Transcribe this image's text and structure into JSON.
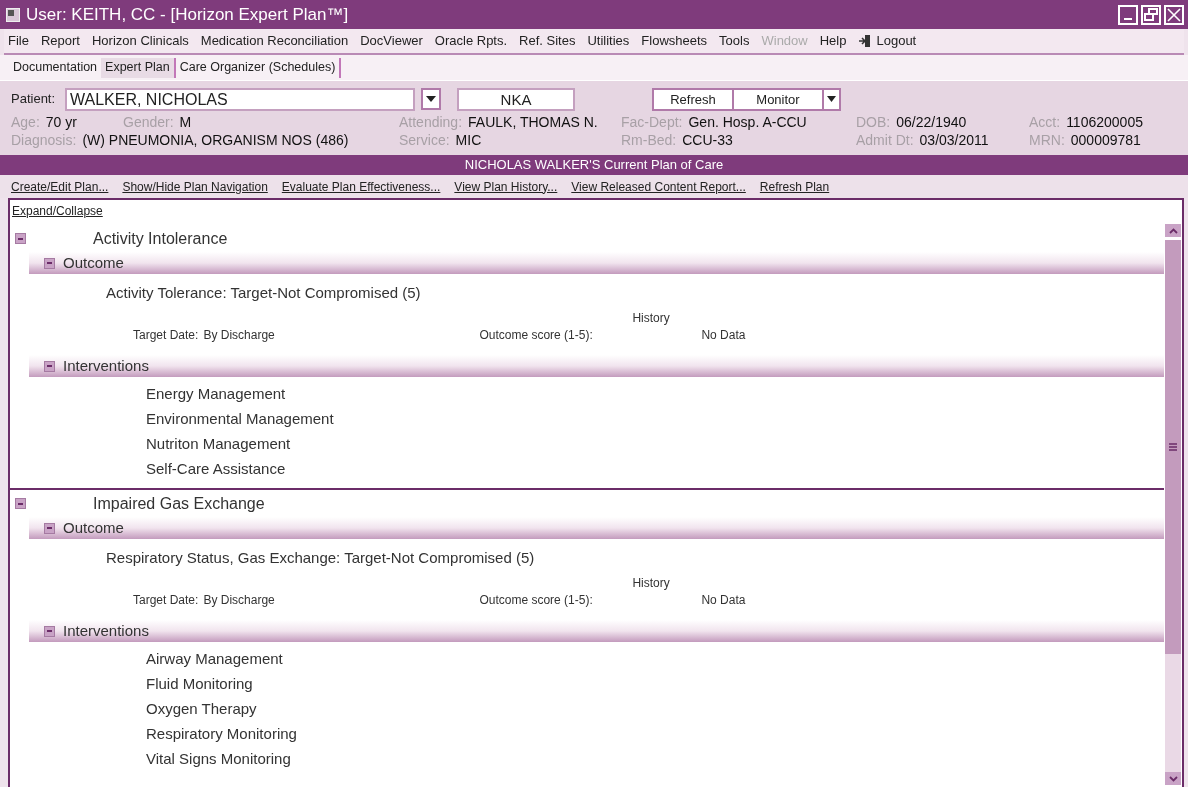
{
  "window": {
    "title": "User: KEITH, CC - [Horizon Expert Plan™]"
  },
  "menu": [
    {
      "label": "File",
      "disabled": false
    },
    {
      "label": "Report",
      "disabled": false
    },
    {
      "label": "Horizon Clinicals",
      "disabled": false
    },
    {
      "label": "Medication Reconciliation",
      "disabled": false
    },
    {
      "label": "DocViewer",
      "disabled": false
    },
    {
      "label": "Oracle Rpts.",
      "disabled": false
    },
    {
      "label": "Ref. Sites",
      "disabled": false
    },
    {
      "label": "Utilities",
      "disabled": false
    },
    {
      "label": "Flowsheets",
      "disabled": false
    },
    {
      "label": "Tools",
      "disabled": false
    },
    {
      "label": "Window",
      "disabled": true
    },
    {
      "label": "Help",
      "disabled": false
    },
    {
      "label": "Logout",
      "disabled": false,
      "kind": "logout"
    }
  ],
  "tabs": [
    {
      "label": "Documentation",
      "selected": false
    },
    {
      "label": "Expert Plan",
      "selected": true
    },
    {
      "label": "Care Organizer (Schedules)",
      "selected": false
    }
  ],
  "patient": {
    "label": "Patient:",
    "value": "WALKER, NICHOLAS",
    "allergy": "NKA",
    "buttons": [
      "Refresh",
      "Monitor"
    ],
    "columns": [
      {
        "lines": [
          [
            {
              "label": "Age:",
              "value": "70 yr"
            },
            {
              "label": "Gender:",
              "value": "M"
            }
          ],
          [
            {
              "label": "Diagnosis:",
              "value": "(W) PNEUMONIA, ORGANISM NOS (486)"
            }
          ]
        ]
      },
      {
        "lines": [
          [
            {
              "label": "Attending:",
              "value": "FAULK, THOMAS N."
            }
          ],
          [
            {
              "label": "Service:",
              "value": "MIC"
            }
          ]
        ]
      },
      {
        "lines": [
          [
            {
              "label": "Fac-Dept:",
              "value": "Gen. Hosp. A-CCU"
            }
          ],
          [
            {
              "label": "Rm-Bed:",
              "value": "CCU-33"
            }
          ]
        ]
      },
      {
        "lines": [
          [
            {
              "label": "DOB:",
              "value": "06/22/1940"
            }
          ],
          [
            {
              "label": "Admit Dt:",
              "value": "03/03/2011"
            }
          ]
        ]
      },
      {
        "lines": [
          [
            {
              "label": "Acct:",
              "value": "1106200005"
            }
          ],
          [
            {
              "label": "MRN:",
              "value": "000009781"
            }
          ]
        ]
      }
    ]
  },
  "plan_header": "NICHOLAS WALKER'S Current Plan of Care",
  "actions": [
    "Create/Edit Plan...",
    "Show/Hide Plan Navigation",
    "Evaluate Plan Effectiveness...",
    "View Plan History...",
    "View Released Content Report...",
    "Refresh Plan"
  ],
  "expand_collapse": "Expand/Collapse",
  "problems": [
    {
      "title": "Activity Intolerance",
      "expanded": true,
      "outcome": {
        "label": "Outcome",
        "expanded": true,
        "name": "Activity Tolerance: Target-Not Compromised (5)",
        "target_date_label": "Target Date:",
        "target_date": "By Discharge",
        "score_label": "Outcome score (1-5):",
        "history": "History",
        "score": "No Data"
      },
      "interventions": {
        "label": "Interventions",
        "expanded": true,
        "items": [
          "Energy Management",
          "Environmental Management",
          "Nutriton Management",
          "Self-Care Assistance"
        ]
      }
    },
    {
      "title": "Impaired Gas Exchange",
      "expanded": true,
      "outcome": {
        "label": "Outcome",
        "expanded": true,
        "name": "Respiratory Status, Gas Exchange: Target-Not Compromised (5)",
        "target_date_label": "Target Date:",
        "target_date": "By Discharge",
        "score_label": "Outcome score (1-5):",
        "history": "History",
        "score": "No Data"
      },
      "interventions": {
        "label": "Interventions",
        "expanded": true,
        "items": [
          "Airway Management",
          "Fluid Monitoring",
          "Oxygen Therapy",
          "Respiratory Monitoring",
          "Vital Signs Monitoring"
        ]
      }
    }
  ]
}
